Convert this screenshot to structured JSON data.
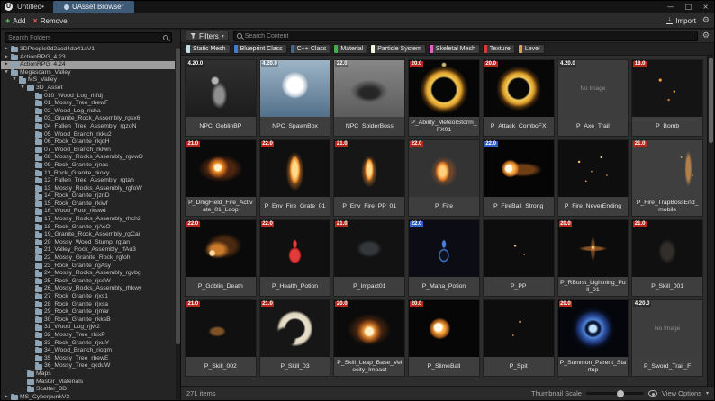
{
  "window": {
    "title": "Untitled•",
    "tab_label": "UAsset Browser"
  },
  "icons": {
    "add": "+",
    "remove": "×",
    "import_arrow": "↓",
    "gear": "⚙",
    "caret_down": "▾",
    "minimize": "—",
    "maximize": "□",
    "close": "×",
    "logo_letter": "U",
    "tree_down": "▼",
    "tree_right": "▶"
  },
  "toolbar": {
    "add_label": "Add",
    "remove_label": "Remove",
    "import_label": "Import"
  },
  "filters": {
    "button_label": "Filters",
    "search_placeholder": "Search Content",
    "chips": [
      {
        "label": "Static Mesh",
        "color": "#bfe0ea"
      },
      {
        "label": "Blueprint Class",
        "color": "#3e7fd4"
      },
      {
        "label": "C++ Class",
        "color": "#49678a"
      },
      {
        "label": "Material",
        "color": "#3faf4c"
      },
      {
        "label": "Particle System",
        "color": "#f2f2e0"
      },
      {
        "label": "Skeletal Mesh",
        "color": "#e261c7"
      },
      {
        "label": "Texture",
        "color": "#cf3b36"
      },
      {
        "label": "Level",
        "color": "#d8a659"
      }
    ]
  },
  "sidebar": {
    "search_placeholder": "Search Folders",
    "tree": [
      {
        "label": "3DPeople9d2acd4da41aV1",
        "depth": 0,
        "arrow": "right"
      },
      {
        "label": "ActionRPG_4.23",
        "depth": 0,
        "arrow": "right"
      },
      {
        "label": "ActionRPG_4.24",
        "depth": 0,
        "arrow": "right",
        "selected": true
      },
      {
        "label": "Megascans_Valley",
        "depth": 0,
        "arrow": "down"
      },
      {
        "label": "MS_Valley",
        "depth": 1,
        "arrow": "down"
      },
      {
        "label": "3D_Asset",
        "depth": 2,
        "arrow": "down"
      },
      {
        "label": "010_Wood_Log_rhfdj",
        "depth": 3
      },
      {
        "label": "01_Mossy_Tree_rbewF",
        "depth": 3
      },
      {
        "label": "02_Wood_Log_richa",
        "depth": 3
      },
      {
        "label": "03_Granite_Rock_Assembly_rgsx6",
        "depth": 3
      },
      {
        "label": "04_Fallen_Tree_Assembly_rgzoN",
        "depth": 3
      },
      {
        "label": "05_Wood_Branch_rkku2",
        "depth": 3
      },
      {
        "label": "06_Rock_Granite_rkjqH",
        "depth": 3
      },
      {
        "label": "07_Wood_Branch_rkiwn",
        "depth": 3
      },
      {
        "label": "08_Mossy_Rocks_Assembly_rgvwD",
        "depth": 3
      },
      {
        "label": "09_Rock_Granite_rjnas",
        "depth": 3
      },
      {
        "label": "11_Rock_Granite_rkoxy",
        "depth": 3
      },
      {
        "label": "12_Fallen_Tree_Assembly_rgtah",
        "depth": 3
      },
      {
        "label": "13_Mossy_Rocks_Assembly_rgfoW",
        "depth": 3
      },
      {
        "label": "14_Rock_Granite_rjznD",
        "depth": 3
      },
      {
        "label": "15_Rock_Granite_rkiwf",
        "depth": 3
      },
      {
        "label": "16_Wood_Root_rkswd",
        "depth": 3
      },
      {
        "label": "17_Mossy_Rocks_Assembly_rhch2",
        "depth": 3
      },
      {
        "label": "18_Rock_Granite_rjAsO",
        "depth": 3
      },
      {
        "label": "19_Granite_Rock_Assembly_rgCai",
        "depth": 3
      },
      {
        "label": "20_Mossy_Wood_Stump_rgtan",
        "depth": 3
      },
      {
        "label": "21_Valley_Rock_Assembly_rfAu3",
        "depth": 3
      },
      {
        "label": "22_Mossy_Granite_Rock_rgfoh",
        "depth": 3
      },
      {
        "label": "23_Rock_Granite_rgAsy",
        "depth": 3
      },
      {
        "label": "24_Mossy_Rocks_Assembly_rgvbg",
        "depth": 3
      },
      {
        "label": "25_Rock_Granite_rjscW",
        "depth": 3
      },
      {
        "label": "26_Mossy_Rocks_Assembly_rhkwy",
        "depth": 3
      },
      {
        "label": "27_Rock_Granite_rjxs1",
        "depth": 3
      },
      {
        "label": "28_Rock_Granite_rjxsa",
        "depth": 3
      },
      {
        "label": "29_Rock_Granite_rjmar",
        "depth": 3
      },
      {
        "label": "30_Rock_Granite_rkksB",
        "depth": 3
      },
      {
        "label": "31_Wood_Log_rjjw2",
        "depth": 3
      },
      {
        "label": "32_Mossy_Tree_rbixP",
        "depth": 3
      },
      {
        "label": "33_Rock_Granite_rjxuY",
        "depth": 3
      },
      {
        "label": "34_Wood_Branch_rioqm",
        "depth": 3
      },
      {
        "label": "35_Mossy_Tree_rbewE",
        "depth": 3
      },
      {
        "label": "36_Mossy_Tree_qkduW",
        "depth": 3
      },
      {
        "label": "Maps",
        "depth": 2
      },
      {
        "label": "Master_Materials",
        "depth": 2
      },
      {
        "label": "Scatter_3D",
        "depth": 2
      },
      {
        "label": "MS_CyberpunkV2",
        "depth": 0,
        "arrow": "right"
      }
    ]
  },
  "assets": {
    "no_image_label": "No Image",
    "items": [
      {
        "name": "NPC_GoblinBP",
        "badge": "4.20.0",
        "badge_type": "plain",
        "thumb": "goblin"
      },
      {
        "name": "NPC_SpawnBox",
        "badge": "4.20.0",
        "badge_type": "plain",
        "thumb": "spawnbox"
      },
      {
        "name": "NPC_SpiderBoss",
        "badge": "22.0",
        "badge_type": "plain",
        "thumb": "spider"
      },
      {
        "name": "P_Ability_MeteorStorm_FX01",
        "badge": "20.0",
        "badge_type": "red",
        "thumb": "ring-gold"
      },
      {
        "name": "P_Attack_ComboFX",
        "badge": "20.0",
        "badge_type": "red",
        "thumb": "ring-gold2"
      },
      {
        "name": "P_Axe_Trail",
        "badge": "4.20.0",
        "badge_type": "plain",
        "thumb": "noimage",
        "no_image": true
      },
      {
        "name": "P_Bomb",
        "badge": "18.0",
        "badge_type": "red",
        "thumb": "embers"
      },
      {
        "name": "P_DmgField_Fire_Activate_01_Loop",
        "badge": "21.0",
        "badge_type": "red",
        "thumb": "explosion"
      },
      {
        "name": "P_Env_Fire_Grate_01",
        "badge": "22.0",
        "badge_type": "red",
        "thumb": "flame-column"
      },
      {
        "name": "P_Env_Fire_PP_01",
        "badge": "21.0",
        "badge_type": "red",
        "thumb": "flame-column2"
      },
      {
        "name": "P_Fire",
        "badge": "22.0",
        "badge_type": "red",
        "thumb": "flame-dark"
      },
      {
        "name": "P_FireBall_Strong",
        "badge": "22.0",
        "badge_type": "blue",
        "thumb": "fireball"
      },
      {
        "name": "P_Fire_NeverEnding",
        "thumb": "sparks"
      },
      {
        "name": "P_Fire_TrapBossEnd_mobile",
        "badge": "21.0",
        "badge_type": "red",
        "thumb": "sparks-gray"
      },
      {
        "name": "P_Goblin_Death",
        "badge": "22.0",
        "badge_type": "red",
        "thumb": "fire-swirl"
      },
      {
        "name": "P_Health_Potion",
        "badge": "22.0",
        "badge_type": "red",
        "thumb": "potion-red"
      },
      {
        "name": "P_Impact01",
        "badge": "21.0",
        "badge_type": "red",
        "thumb": "dim"
      },
      {
        "name": "P_Mana_Potion",
        "badge": "22.0",
        "badge_type": "blue",
        "thumb": "potion-blue"
      },
      {
        "name": "P_PP",
        "thumb": "sparks-few"
      },
      {
        "name": "P_RBurst_Lightning_Pull_01",
        "badge": "20.0",
        "badge_type": "red",
        "thumb": "sparks-burst"
      },
      {
        "name": "P_Skill_001",
        "badge": "21.0",
        "badge_type": "red",
        "thumb": "dim2"
      },
      {
        "name": "P_Skill_002",
        "badge": "21.0",
        "badge_type": "red",
        "thumb": "dim-orange"
      },
      {
        "name": "P_Skill_03",
        "badge": "21.0",
        "badge_type": "red",
        "thumb": "crescent"
      },
      {
        "name": "P_Skill_Leap_Base_Velocity_Impact",
        "badge": "20.0",
        "badge_type": "red",
        "thumb": "explosion2"
      },
      {
        "name": "P_SlimeBall",
        "badge": "20.0",
        "badge_type": "red",
        "thumb": "fireball2"
      },
      {
        "name": "P_Spit",
        "thumb": "sparks-few2"
      },
      {
        "name": "P_Summon_Parent_Startup",
        "badge": "20.0",
        "badge_type": "red",
        "thumb": "ring-blue"
      },
      {
        "name": "P_Sword_Trail_F",
        "badge": "4.20.0",
        "badge_type": "plain",
        "thumb": "noimage",
        "no_image": true
      }
    ]
  },
  "statusbar": {
    "items_count": "271 items",
    "thumbnail_scale_label": "Thumbnail Scale",
    "view_options_label": "View Options"
  }
}
